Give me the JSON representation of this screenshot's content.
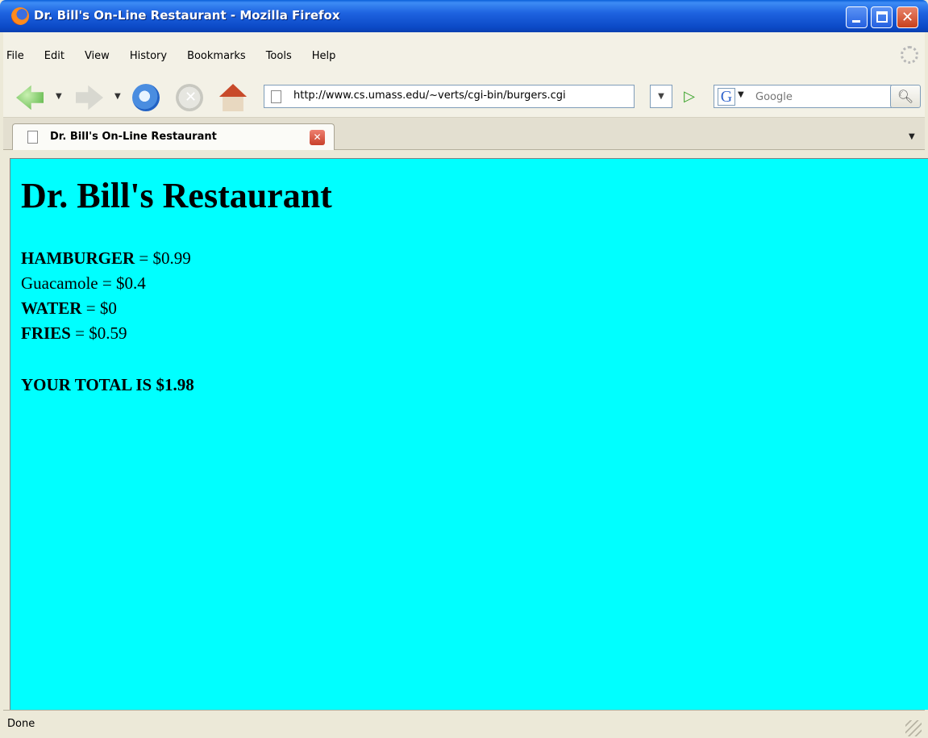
{
  "window": {
    "title": "Dr. Bill's On-Line Restaurant - Mozilla Firefox",
    "controls": {
      "minimize": "minimize-icon",
      "maximize": "maximize-icon",
      "close": "close-icon"
    }
  },
  "menubar": {
    "items": [
      "File",
      "Edit",
      "View",
      "History",
      "Bookmarks",
      "Tools",
      "Help"
    ]
  },
  "navbar": {
    "url": "http://www.cs.umass.edu/~verts/cgi-bin/burgers.cgi",
    "search_placeholder": "Google"
  },
  "tabs": [
    {
      "label": "Dr. Bill's On-Line Restaurant",
      "active": true
    }
  ],
  "page": {
    "background": "#00ffff",
    "heading": "Dr. Bill's Restaurant",
    "items": [
      {
        "name": "HAMBURGER",
        "eq": " = ",
        "price": "$0.99",
        "name_bold": true
      },
      {
        "name": "Guacamole",
        "eq": " = ",
        "price": "$0.4",
        "name_bold": false
      },
      {
        "name": "WATER",
        "eq": " = ",
        "price": "$0",
        "name_bold": true
      },
      {
        "name": "FRIES",
        "eq": " = ",
        "price": "$0.59",
        "name_bold": true
      }
    ],
    "total": "YOUR TOTAL IS $1.98"
  },
  "statusbar": {
    "text": "Done"
  }
}
